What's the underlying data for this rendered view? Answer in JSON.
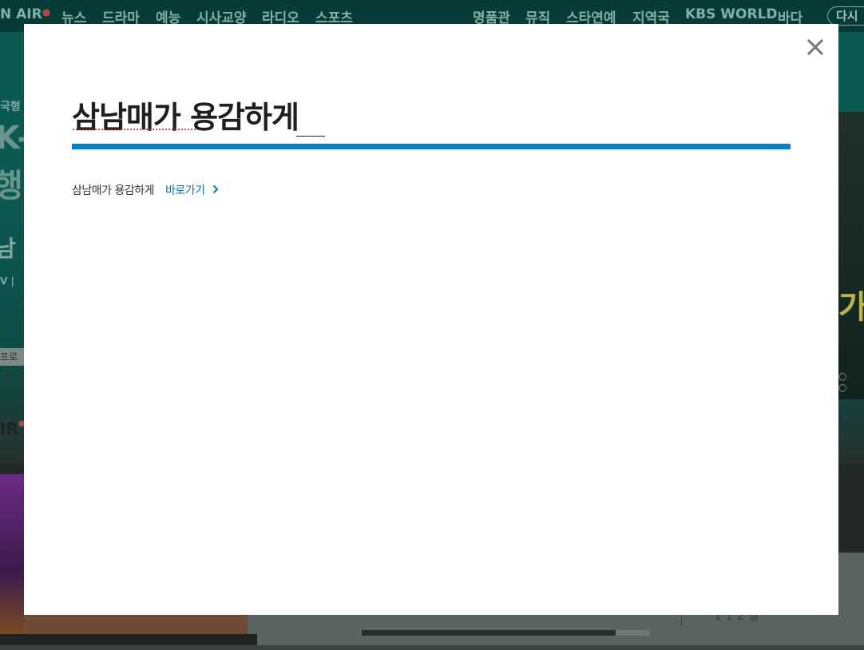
{
  "background": {
    "nav_left": [
      "N AIR",
      "뉴스",
      "드라마",
      "예능",
      "시사교양",
      "라디오",
      "스포츠"
    ],
    "nav_right": [
      "명품관",
      "뮤직",
      "스타연예",
      "지역국",
      "KBS WORLD",
      "바다"
    ],
    "redo_label": "다시",
    "hero_small_label": "국형",
    "hero_big_1": "K-",
    "hero_big_2": "행",
    "hero_big_3": "남",
    "hero_meta": "V |",
    "program_tag": "프로그",
    "onair_small": "IR",
    "right_text": "가",
    "pager_dots": "○ ○",
    "lower_small": "1 1 2 일"
  },
  "modal": {
    "title": "삼남매가 용감하게",
    "program_name": "삼남매가 용감하게",
    "go_link": "바로가기",
    "accent_color": "#0a7fc5",
    "close_icon": "close-icon",
    "chevron_icon": "chevron-right-icon"
  }
}
